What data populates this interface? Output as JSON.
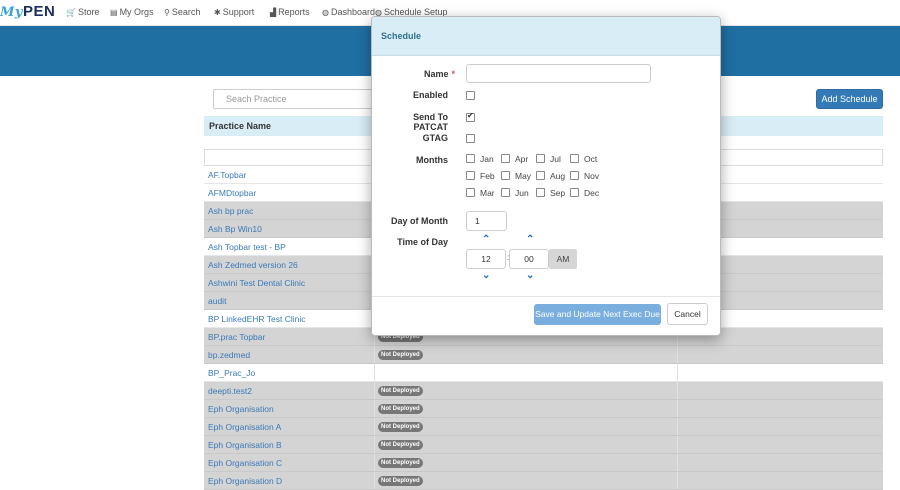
{
  "nav": {
    "logo_my": "My",
    "logo_pen": "PEN",
    "items": [
      {
        "label": "Store",
        "icon": "cart-icon",
        "glyph": "🛒"
      },
      {
        "label": "My Orgs",
        "icon": "folder-icon",
        "glyph": "▤"
      },
      {
        "label": "Search",
        "icon": "search-icon",
        "glyph": "⚲"
      },
      {
        "label": "Support",
        "icon": "gear-icon",
        "glyph": "✱"
      },
      {
        "label": "Reports",
        "icon": "bar-chart-icon",
        "glyph": "▟"
      },
      {
        "label": "Dashboard",
        "icon": "dashboard-icon",
        "glyph": "◍"
      },
      {
        "label": "Schedule Setup",
        "icon": "schedule-icon",
        "glyph": "◍"
      }
    ]
  },
  "page": {
    "search_placeholder": "Seach Practice",
    "add_button": "Add Schedule",
    "column_practice": "Practice Name",
    "badge_text": "Not Deployed",
    "rows": [
      {
        "name": "AF.Topbar",
        "shade": "white",
        "badge": false
      },
      {
        "name": "AFMDtopbar",
        "shade": "white",
        "badge": false
      },
      {
        "name": "Ash bp prac",
        "shade": "gray",
        "badge": false
      },
      {
        "name": "Ash Bp Win10",
        "shade": "gray",
        "badge": false
      },
      {
        "name": "Ash Topbar test - BP",
        "shade": "white",
        "badge": false
      },
      {
        "name": "Ash Zedmed version 26",
        "shade": "gray",
        "badge": false
      },
      {
        "name": "Ashwini Test Dental Clinic",
        "shade": "gray",
        "badge": false
      },
      {
        "name": "audit",
        "shade": "gray",
        "badge": false
      },
      {
        "name": "BP LinkedEHR Test Clinic",
        "shade": "white",
        "badge": false
      },
      {
        "name": "BP.prac Topbar",
        "shade": "gray",
        "badge": true
      },
      {
        "name": "bp.zedmed",
        "shade": "gray",
        "badge": true
      },
      {
        "name": "BP_Prac_Jo",
        "shade": "white",
        "badge": false
      },
      {
        "name": "deepti.test2",
        "shade": "gray",
        "badge": true
      },
      {
        "name": "Eph Organisation",
        "shade": "gray",
        "badge": true
      },
      {
        "name": "Eph Organisation A",
        "shade": "gray",
        "badge": true
      },
      {
        "name": "Eph Organisation B",
        "shade": "gray",
        "badge": true
      },
      {
        "name": "Eph Organisation C",
        "shade": "gray",
        "badge": true
      },
      {
        "name": "Eph Organisation D",
        "shade": "gray",
        "badge": true
      }
    ]
  },
  "modal": {
    "title": "Schedule",
    "name_label": "Name",
    "required_mark": "*",
    "name_value": "",
    "enabled_label": "Enabled",
    "enabled": false,
    "patcat_label": "Send To PATCAT",
    "patcat": true,
    "gtag_label": "GTAG",
    "gtag": false,
    "months_label": "Months",
    "months": [
      [
        "Jan",
        "Apr",
        "Jul",
        "Oct"
      ],
      [
        "Feb",
        "May",
        "Aug",
        "Nov"
      ],
      [
        "Mar",
        "Jun",
        "Sep",
        "Dec"
      ]
    ],
    "day_label": "Day of Month",
    "day_value": "1",
    "time_label": "Time of Day",
    "hour": "12",
    "minute": "00",
    "time_sep": ":",
    "ampm": "AM",
    "save_button": "Save and Update Next Exec Due",
    "cancel_button": "Cancel"
  }
}
